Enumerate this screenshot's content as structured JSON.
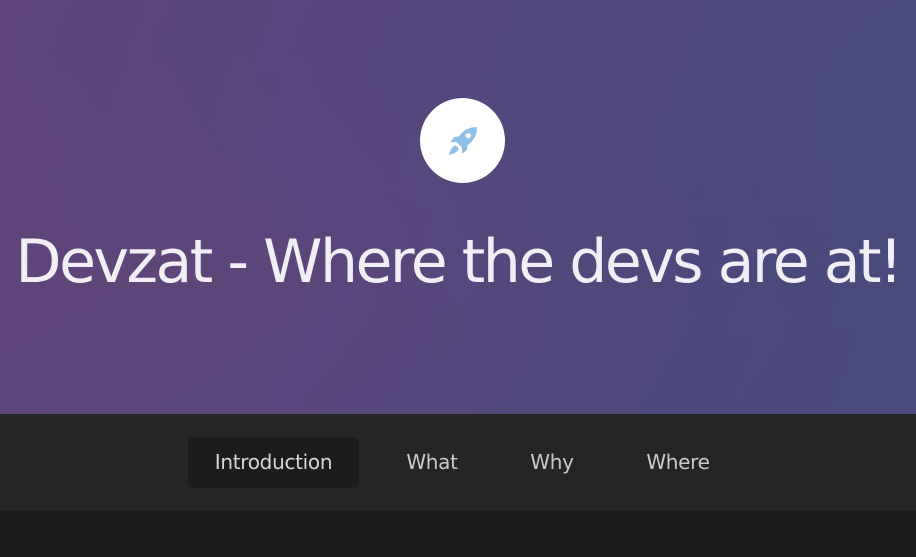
{
  "hero": {
    "logo_icon": "rocket-icon",
    "title": "Devzat - Where the devs are at!"
  },
  "nav": {
    "items": [
      {
        "label": "Introduction",
        "active": true
      },
      {
        "label": "What",
        "active": false
      },
      {
        "label": "Why",
        "active": false
      },
      {
        "label": "Where",
        "active": false
      }
    ]
  },
  "colors": {
    "hero_gradient_start": "#5e4479",
    "hero_gradient_end": "#4a4a7c",
    "logo_icon_color": "#8fc0e8",
    "nav_background": "#252527",
    "nav_active_background": "#1c1c1e",
    "page_background": "#1b1b1d"
  }
}
